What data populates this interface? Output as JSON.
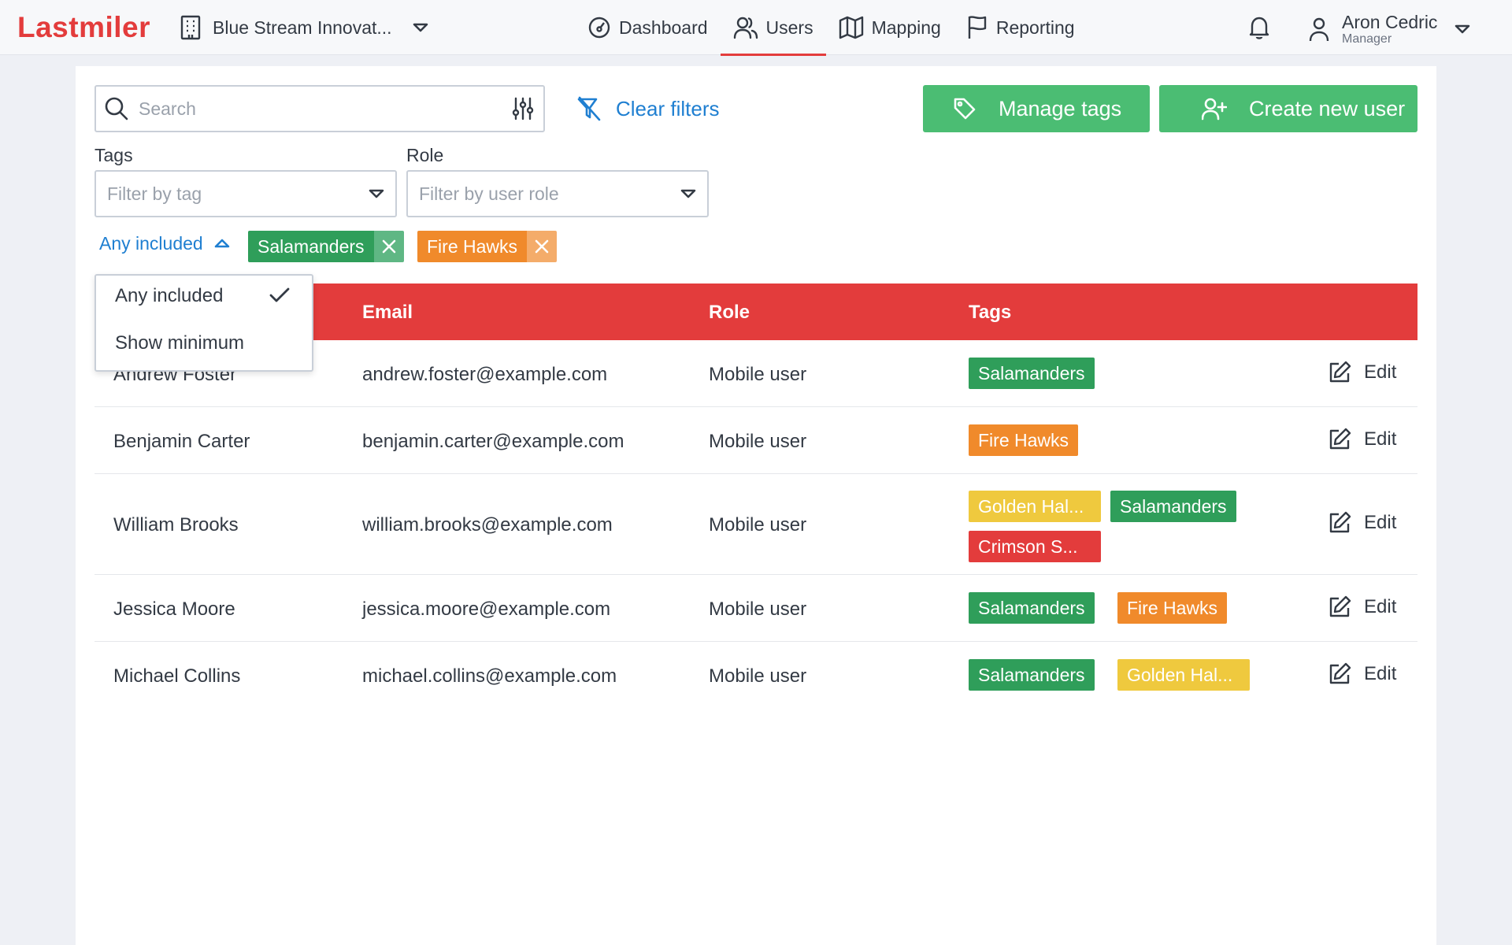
{
  "app": {
    "logo": "Lastmiler"
  },
  "header": {
    "company": "Blue Stream Innovat...",
    "nav": [
      {
        "label": "Dashboard",
        "icon": "dashboard-icon"
      },
      {
        "label": "Users",
        "icon": "users-icon",
        "active": true
      },
      {
        "label": "Mapping",
        "icon": "map-icon"
      },
      {
        "label": "Reporting",
        "icon": "flag-icon"
      }
    ],
    "user": {
      "name": "Aron Cedric",
      "role": "Manager"
    }
  },
  "toolbar": {
    "search_placeholder": "Search",
    "clear_filters": "Clear filters",
    "manage_tags": "Manage tags",
    "create_user": "Create new user"
  },
  "filters": {
    "tags_label": "Tags",
    "tags_placeholder": "Filter by tag",
    "role_label": "Role",
    "role_placeholder": "Filter by user role",
    "match_mode": "Any included",
    "active_tags": [
      "Salamanders",
      "Fire Hawks"
    ]
  },
  "match_menu": {
    "options": [
      "Any included",
      "Show minimum"
    ],
    "selected": "Any included"
  },
  "table": {
    "columns": [
      "Email",
      "Role",
      "Tags"
    ],
    "edit_label": "Edit",
    "rows": [
      {
        "name": "Andrew Foster",
        "email": "andrew.foster@example.com",
        "role": "Mobile user",
        "tags": [
          "Salamanders"
        ]
      },
      {
        "name": "Benjamin Carter",
        "email": "benjamin.carter@example.com",
        "role": "Mobile user",
        "tags": [
          "Fire Hawks"
        ]
      },
      {
        "name": "William Brooks",
        "email": "william.brooks@example.com",
        "role": "Mobile user",
        "tags": [
          "Golden Hal...",
          "Salamanders",
          "Crimson S..."
        ]
      },
      {
        "name": "Jessica Moore",
        "email": "jessica.moore@example.com",
        "role": "Mobile user",
        "tags": [
          "Salamanders",
          "Fire Hawks"
        ]
      },
      {
        "name": "Michael Collins",
        "email": "michael.collins@example.com",
        "role": "Mobile user",
        "tags": [
          "Salamanders",
          "Golden Hal..."
        ]
      }
    ]
  },
  "colors": {
    "brand_red": "#e33c3c",
    "link_blue": "#1f7fd1",
    "button_green": "#4bbd73",
    "tag_salamanders": "#2f9e5a",
    "tag_fire_hawks": "#f08a2b",
    "tag_golden": "#efc93e",
    "tag_crimson": "#e33c3c"
  }
}
